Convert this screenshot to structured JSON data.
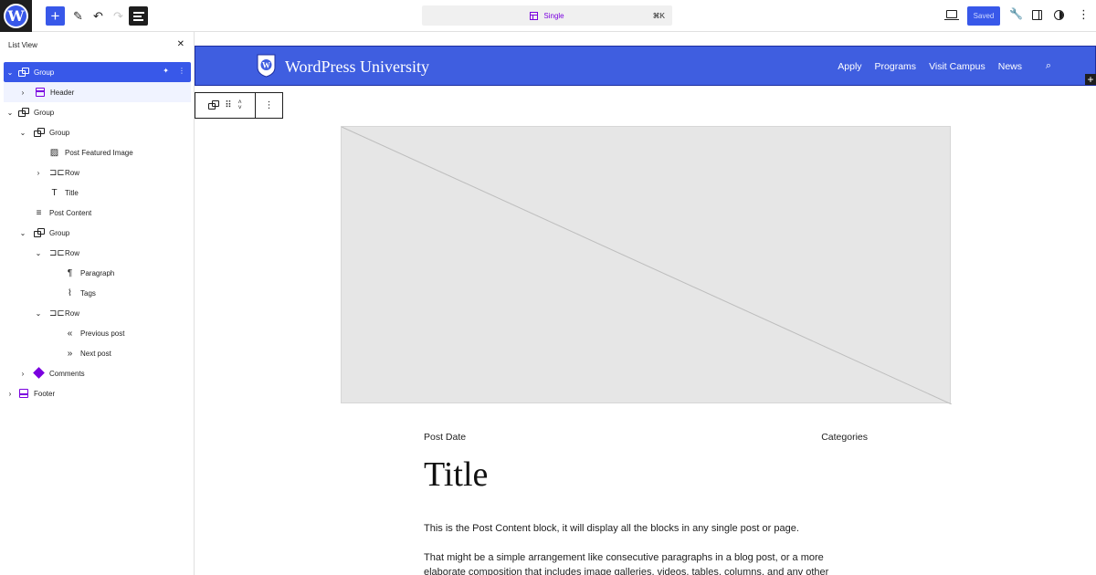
{
  "toolbar": {
    "command_center_label": "Single",
    "command_center_shortcut": "⌘K",
    "saved_label": "Saved"
  },
  "list_view": {
    "title": "List View",
    "items": [
      {
        "label": "Group",
        "icon": "group-icon",
        "depth": 0,
        "expanded": true,
        "selected": true
      },
      {
        "label": "Header",
        "icon": "header-icon",
        "depth": 1,
        "expanded": false
      },
      {
        "label": "Group",
        "icon": "group-icon",
        "depth": 0,
        "expanded": true
      },
      {
        "label": "Group",
        "icon": "group-icon",
        "depth": 1,
        "expanded": true
      },
      {
        "label": "Post Featured Image",
        "icon": "featured-image-icon",
        "depth": 2
      },
      {
        "label": "Row",
        "icon": "row-icon",
        "depth": 2,
        "expanded": false
      },
      {
        "label": "Title",
        "icon": "title-icon",
        "depth": 2
      },
      {
        "label": "Post Content",
        "icon": "post-content-icon",
        "depth": 1
      },
      {
        "label": "Group",
        "icon": "group-icon",
        "depth": 1,
        "expanded": true
      },
      {
        "label": "Row",
        "icon": "row-icon",
        "depth": 2,
        "expanded": true
      },
      {
        "label": "Paragraph",
        "icon": "paragraph-icon",
        "depth": 3
      },
      {
        "label": "Tags",
        "icon": "tags-icon",
        "depth": 3
      },
      {
        "label": "Row",
        "icon": "row-icon",
        "depth": 2,
        "expanded": true
      },
      {
        "label": "Previous post",
        "icon": "previous-post-icon",
        "depth": 3
      },
      {
        "label": "Next post",
        "icon": "next-post-icon",
        "depth": 3
      },
      {
        "label": "Comments",
        "icon": "comments-icon",
        "depth": 1,
        "expanded": false
      },
      {
        "label": "Footer",
        "icon": "footer-icon",
        "depth": 0,
        "expanded": false
      }
    ]
  },
  "site": {
    "title": "WordPress University",
    "nav": [
      "Apply",
      "Programs",
      "Visit Campus",
      "News"
    ]
  },
  "post": {
    "date": "Post Date",
    "categories": "Categories",
    "title": "Title",
    "content_p1": "This is the Post Content block, it will display all the blocks in any single post or page.",
    "content_p2": "That might be a simple arrangement like consecutive paragraphs in a blog post, or a more elaborate composition that includes image galleries, videos, tables, columns, and any other"
  },
  "colors": {
    "accent": "#3858e9",
    "header_bg": "#3f5ee0",
    "template_purple": "#7a00df"
  }
}
